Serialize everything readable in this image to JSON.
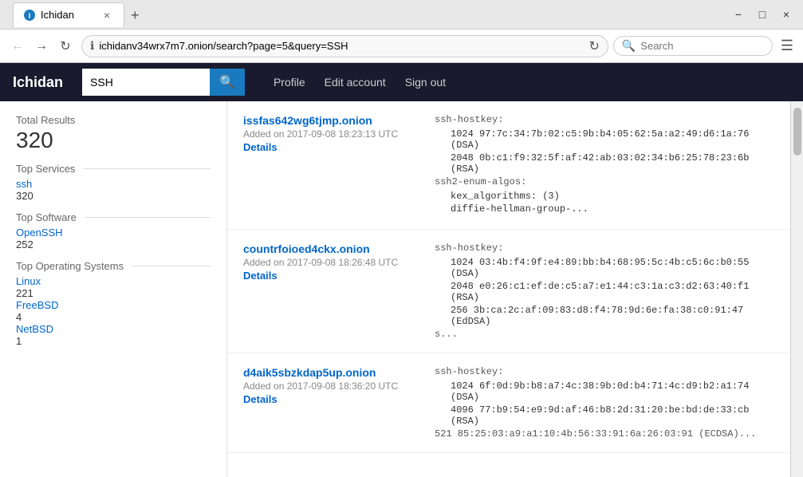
{
  "window": {
    "title": "Ichidan",
    "tab_label": "Ichidan",
    "close_label": "×",
    "minimize_label": "−",
    "maximize_label": "□"
  },
  "address_bar": {
    "url": "ichidanv34wrx7m7.onion/search?page=5&query=SSH",
    "search_placeholder": "Search"
  },
  "app_nav": {
    "logo": "Ichidan",
    "search_value": "SSH",
    "search_button_icon": "🔍",
    "links": [
      {
        "label": "Profile",
        "id": "profile"
      },
      {
        "label": "Edit account",
        "id": "edit-account"
      },
      {
        "label": "Sign out",
        "id": "sign-out"
      }
    ]
  },
  "sidebar": {
    "total_results_label": "Total Results",
    "total_results_value": "320",
    "sections": [
      {
        "title": "Top Services",
        "items": [
          {
            "label": "ssh",
            "count": "320"
          }
        ]
      },
      {
        "title": "Top Software",
        "items": [
          {
            "label": "OpenSSH",
            "count": "252"
          }
        ]
      },
      {
        "title": "Top Operating Systems",
        "items": [
          {
            "label": "Linux",
            "count": "221"
          },
          {
            "label": "FreeBSD",
            "count": "4"
          },
          {
            "label": "NetBSD",
            "count": "1"
          }
        ]
      }
    ]
  },
  "results": [
    {
      "domain": "issfas642wg6tjmp.onion",
      "added": "Added on 2017-09-08 18:23:13 UTC",
      "details_label": "Details",
      "content_lines": [
        {
          "type": "label",
          "text": "ssh-hostkey:"
        },
        {
          "type": "indent",
          "text": "1024 97:7c:34:7b:02:c5:9b:b4:05:62:5a:a2:49:d6:1a:76 (DSA)"
        },
        {
          "type": "indent",
          "text": "2048 0b:c1:f9:32:5f:af:42:ab:03:02:34:b6:25:78:23:6b (RSA)"
        },
        {
          "type": "label",
          "text": "ssh2-enum-algos:"
        },
        {
          "type": "indent",
          "text": "kex_algorithms: (3)"
        },
        {
          "type": "indent",
          "text": "diffie-hellman-group-..."
        }
      ]
    },
    {
      "domain": "countrfoioed4ckx.onion",
      "added": "Added on 2017-09-08 18:26:48 UTC",
      "details_label": "Details",
      "content_lines": [
        {
          "type": "label",
          "text": "ssh-hostkey:"
        },
        {
          "type": "indent",
          "text": "1024 03:4b:f4:9f:e4:89:bb:b4:68:95:5c:4b:c5:6c:b0:55 (DSA)"
        },
        {
          "type": "indent",
          "text": "2048 e0:26:c1:ef:de:c5:a7:e1:44:c3:1a:c3:d2:63:40:f1 (RSA)"
        },
        {
          "type": "indent",
          "text": "256 3b:ca:2c:af:09:83:d8:f4:78:9d:6e:fa:38:c0:91:47 (EdDSA)"
        },
        {
          "type": "truncated",
          "text": "s..."
        }
      ]
    },
    {
      "domain": "d4aik5sbzkdap5up.onion",
      "added": "Added on 2017-09-08 18:36:20 UTC",
      "details_label": "Details",
      "content_lines": [
        {
          "type": "label",
          "text": "ssh-hostkey:"
        },
        {
          "type": "indent",
          "text": "1024 6f:0d:9b:b8:a7:4c:38:9b:0d:b4:71:4c:d9:b2:a1:74 (DSA)"
        },
        {
          "type": "indent",
          "text": "4096 77:b9:54:e9:9d:af:46:b8:2d:31:20:be:bd:de:33:cb (RSA)"
        },
        {
          "type": "truncated",
          "text": "521 85:25:03:a9:a1:10:4b:56:33:91:6a:26:03:91 (ECDSA)..."
        }
      ]
    }
  ]
}
